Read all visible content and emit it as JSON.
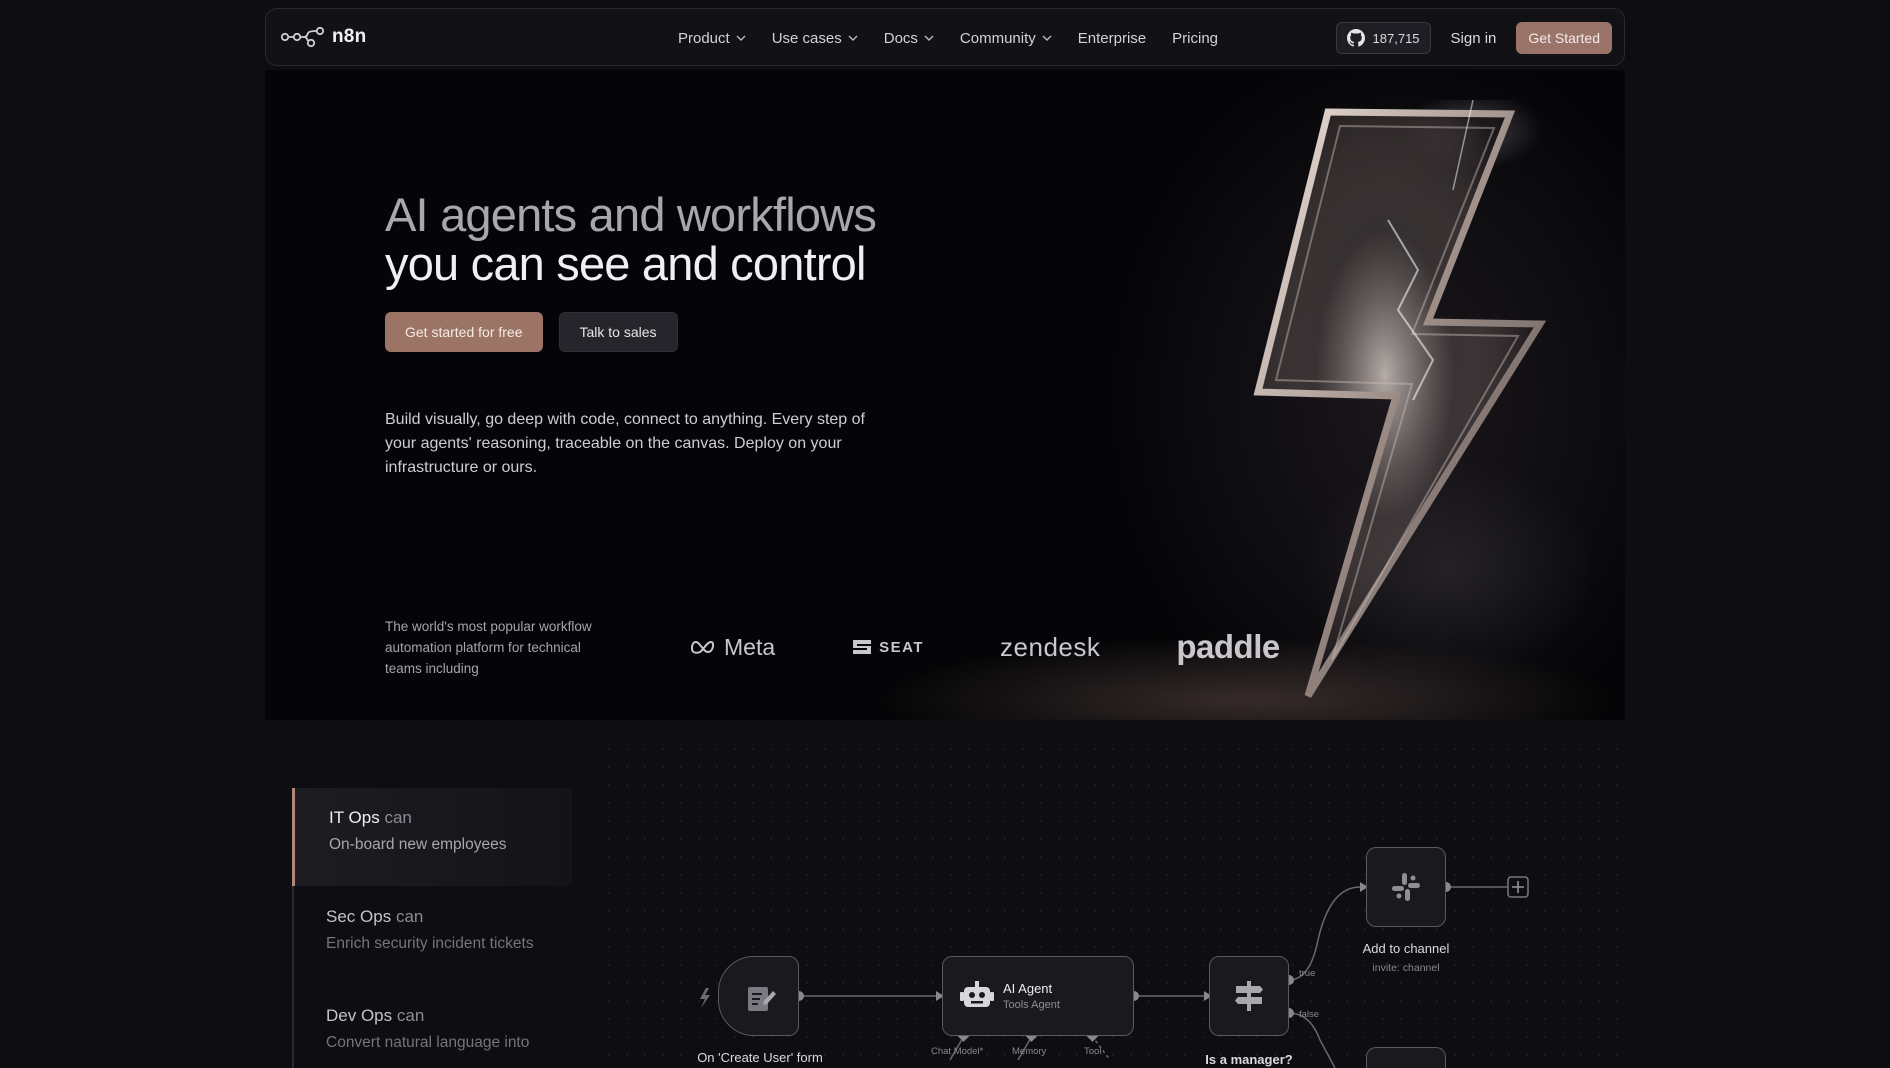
{
  "nav": {
    "logo_text": "n8n",
    "items": [
      {
        "label": "Product",
        "has_dropdown": true
      },
      {
        "label": "Use cases",
        "has_dropdown": true
      },
      {
        "label": "Docs",
        "has_dropdown": true
      },
      {
        "label": "Community",
        "has_dropdown": true
      },
      {
        "label": "Enterprise",
        "has_dropdown": false
      },
      {
        "label": "Pricing",
        "has_dropdown": false
      }
    ],
    "github_stars": "187,715",
    "signin_label": "Sign in",
    "get_started_label": "Get Started"
  },
  "hero": {
    "title_line1": "AI agents and workflows",
    "title_line2": "you can see and control",
    "cta_primary": "Get started for free",
    "cta_secondary": "Talk to sales",
    "description": "Build visually, go deep with code, connect to anything. Every step of your agents' reasoning, traceable on the canvas. Deploy on your infrastructure or ours."
  },
  "trust": {
    "text": "The world's most popular workflow automation platform for technical teams including",
    "brands": [
      "Meta",
      "SEAT",
      "zendesk",
      "paddle"
    ]
  },
  "use_cases": [
    {
      "team": "IT Ops",
      "can": "can",
      "task": "On-board new employees",
      "active": true
    },
    {
      "team": "Sec Ops",
      "can": "can",
      "task": "Enrich security incident tickets",
      "active": false
    },
    {
      "team": "Dev Ops",
      "can": "can",
      "task": "Convert natural language into",
      "active": false
    }
  ],
  "workflow": {
    "trigger_label": "On 'Create User' form",
    "agent_title": "AI Agent",
    "agent_sub": "Tools Agent",
    "agent_ports": [
      "Chat Model*",
      "Memory",
      "Tool"
    ],
    "if_label": "Is a manager?",
    "branch_true": "true",
    "branch_false": "false",
    "slack_label": "Add to channel",
    "slack_sub": "invite: channel"
  },
  "colors": {
    "accent": "#9b7466",
    "background": "#0e0d12"
  }
}
